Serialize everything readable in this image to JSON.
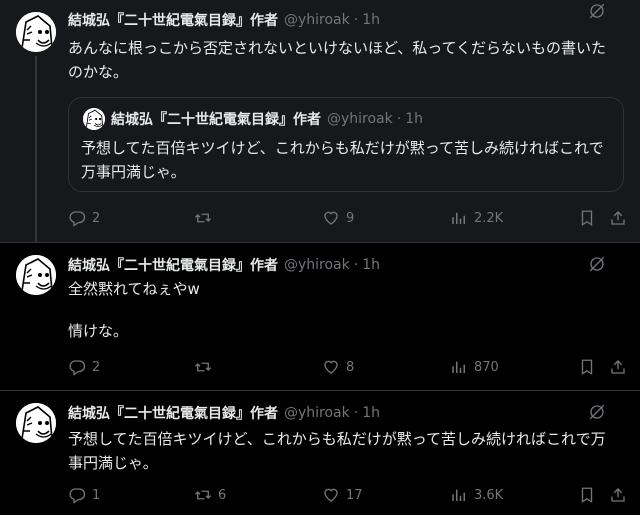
{
  "author": {
    "name": "結城弘『二十世紀電氣目録』作者",
    "handle": "@yhiroak",
    "separator": "·"
  },
  "tweets": [
    {
      "time": "1h",
      "text": "あんなに根っこから否定されないといけないほど、私ってくだらないもの書いたのかな。",
      "quote": {
        "time": "1h",
        "text": "予想してた百倍キツイけど、これからも私だけが黙って苦しみ続ければこれで万事円満じゃ。"
      },
      "replies": "2",
      "reposts": "",
      "likes": "9",
      "views": "2.2K"
    },
    {
      "time": "1h",
      "text_line1": "全然黙れてねぇやw",
      "text_line2": "情けな。",
      "replies": "2",
      "reposts": "",
      "likes": "8",
      "views": "870"
    },
    {
      "time": "1h",
      "text": "予想してた百倍キツイけど、これからも私だけが黙って苦しみ続ければこれで万事円満じゃ。",
      "replies": "1",
      "reposts": "6",
      "likes": "17",
      "views": "3.6K"
    }
  ],
  "icons": {
    "reply": "reply-icon",
    "repost": "repost-icon",
    "like": "heart-icon",
    "views": "views-icon",
    "bookmark": "bookmark-icon",
    "share": "share-icon",
    "grok": "grok-icon",
    "avatar": "avatar-image"
  },
  "colors": {
    "background": "#000000",
    "highlight": "#16181c",
    "text": "#e7e9ea",
    "muted": "#71767b",
    "border": "#2f3336"
  }
}
